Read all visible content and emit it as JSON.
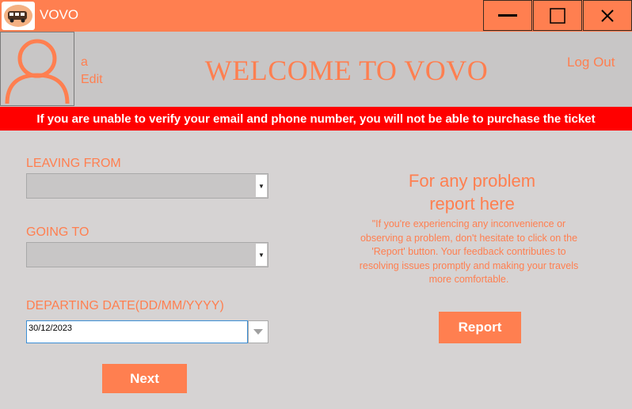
{
  "window": {
    "title": "VOVO",
    "minimize_icon": "minimize-icon",
    "maximize_icon": "maximize-icon",
    "close_icon": "close-icon"
  },
  "header": {
    "username": "a",
    "edit_label": "Edit",
    "welcome": "WELCOME TO VOVO",
    "logout_label": "Log Out"
  },
  "alert": {
    "text": "If you are unable to verify your email and phone number, you will not be able to purchase the ticket"
  },
  "form": {
    "leaving_label": "LEAVING FROM",
    "leaving_value": "",
    "going_label": "GOING TO",
    "going_value": "",
    "date_label": "DEPARTING DATE(DD/MM/YYYY)",
    "date_value": "30/12/2023",
    "next_label": "Next"
  },
  "report": {
    "title_line1": "For any problem",
    "title_line2": "report here",
    "description": "\"If you're experiencing any inconvenience or observing a problem, don't hesitate to click on the 'Report' button. Your feedback contributes to resolving issues promptly and making your travels more comfortable.",
    "button_label": "Report"
  },
  "colors": {
    "accent": "#ff7f50",
    "background": "#d6d3d3",
    "header": "#c8c6c6",
    "alert": "#ff0000"
  }
}
